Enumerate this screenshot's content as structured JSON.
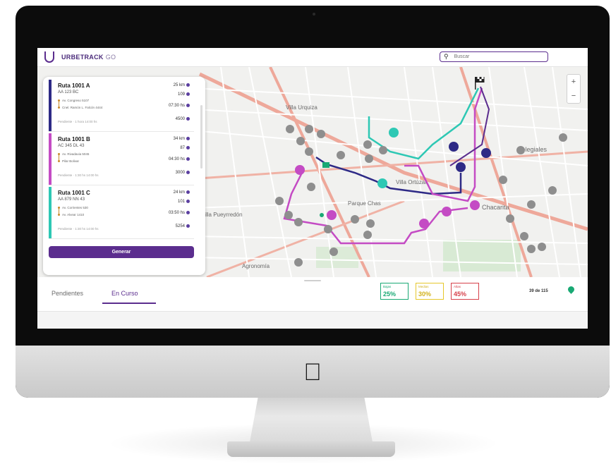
{
  "app": {
    "brand": "URBETRACK",
    "brand_suffix": "GO"
  },
  "search": {
    "placeholder": "Buscar"
  },
  "map": {
    "labels": [
      "Villa Ortúzar",
      "Parque Chas",
      "Chacarita",
      "Colegiales",
      "Agronomía",
      "Villa Pueyrredón",
      "Villa Urquiza"
    ],
    "zoom_in": "+",
    "zoom_out": "−"
  },
  "routes": [
    {
      "title": "Ruta 1001 A",
      "plate": "AA 123 BC",
      "origin": "Av. Congreso 5107",
      "destination": "Cnel. Ramón L. Falcón 4444",
      "footer": "Pendiente · 1 hora 14:00 hs",
      "distance": "25 km",
      "stops": "109",
      "time": "07:30 hs",
      "count": "4500",
      "color": "#2e2a86"
    },
    {
      "title": "Ruta 1001 B",
      "plate": "AC 345 DL 43",
      "origin": "Av. Rivadavia 5045",
      "destination": "Pilar Bolivar",
      "footer": "Pendiente · 1:30 hs 14:00 hs",
      "distance": "34 km",
      "stops": "87",
      "time": "04:30 hs",
      "count": "3000",
      "color": "#c44bc4"
    },
    {
      "title": "Ruta 1001 C",
      "plate": "AA 879 NN 43",
      "origin": "Av. Corrientes 530",
      "destination": "Av. Alvear 1410",
      "footer": "Pendiente · 1:30 hs 14:00 hs",
      "distance": "24 km",
      "stops": "101",
      "time": "03:50 hs",
      "count": "5254",
      "color": "#2ec8b4"
    }
  ],
  "panel": {
    "generate_label": "Generar"
  },
  "tabs": [
    {
      "label": "Pendientes",
      "active": false
    },
    {
      "label": "En Curso",
      "active": true
    }
  ],
  "stats": [
    {
      "label": "Bajas",
      "value": "25%",
      "color": "#19a974"
    },
    {
      "label": "Medias",
      "value": "30%",
      "color": "#e6c72a"
    },
    {
      "label": "Altas",
      "value": "45%",
      "color": "#d6404a"
    }
  ],
  "counter": "39 de 115"
}
